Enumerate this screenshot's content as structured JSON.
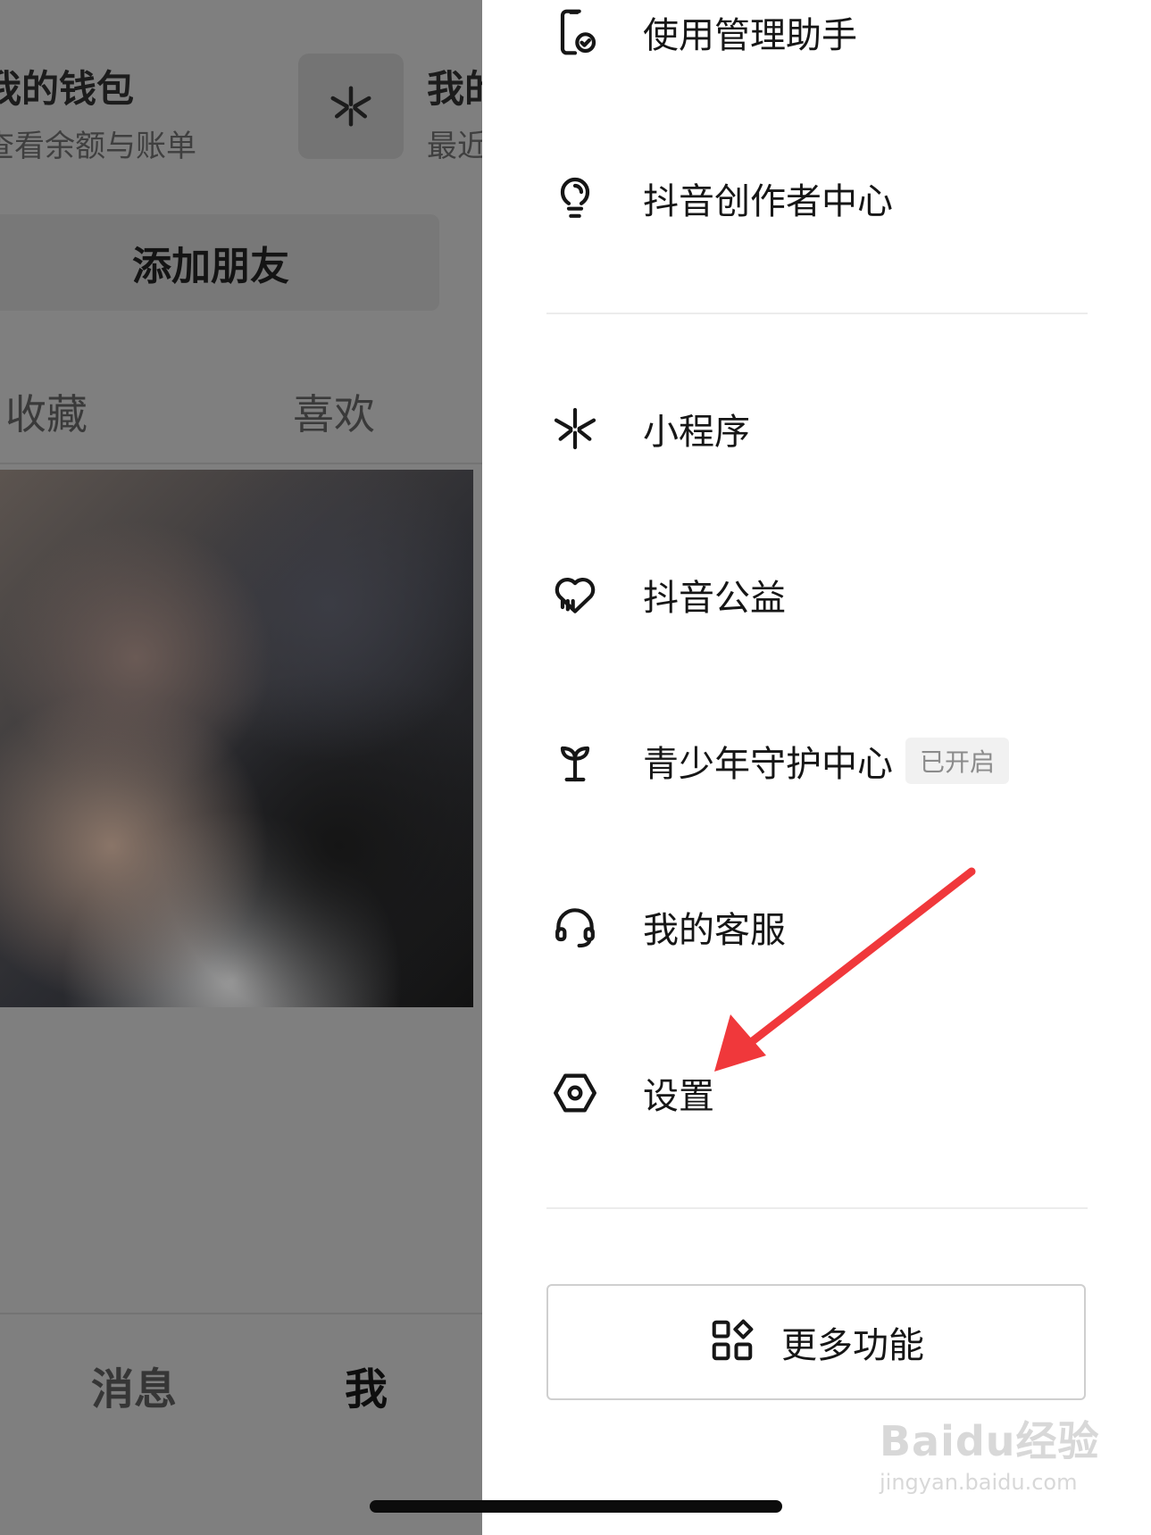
{
  "background_page": {
    "wallet": {
      "title": "我的钱包",
      "subtitle": "查看余额与账单"
    },
    "mini_program_tile": {
      "icon": "mini-program-icon"
    },
    "my_card": {
      "title": "我的",
      "subtitle": "最近"
    },
    "add_friend_label": "添加朋友",
    "tabs": [
      "收藏",
      "喜欢"
    ],
    "bottom_nav": [
      "消息",
      "我"
    ]
  },
  "drawer": {
    "items": [
      {
        "label": "使用管理助手",
        "icon": "phone-check-icon"
      },
      {
        "label": "抖音创作者中心",
        "icon": "lightbulb-icon"
      },
      {
        "label": "小程序",
        "icon": "mini-program-icon"
      },
      {
        "label": "抖音公益",
        "icon": "heart-charity-icon"
      },
      {
        "label": "青少年守护中心",
        "icon": "sprout-icon",
        "badge": "已开启"
      },
      {
        "label": "我的客服",
        "icon": "headset-icon"
      },
      {
        "label": "设置",
        "icon": "hexagon-gear-icon"
      }
    ],
    "more_button": {
      "label": "更多功能",
      "icon": "apps-grid-icon"
    }
  },
  "annotation": {
    "color": "#f0383b"
  },
  "watermark": {
    "logo": "Baidu经验",
    "url": "jingyan.baidu.com"
  }
}
